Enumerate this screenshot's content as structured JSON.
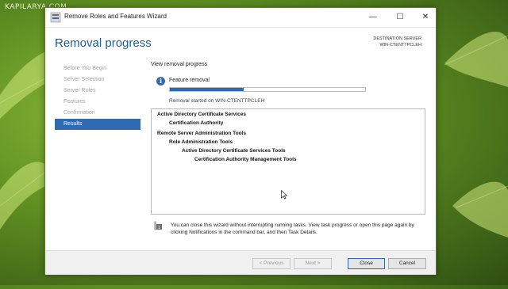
{
  "watermark": "KAPILARYA.COM",
  "window": {
    "title": "Remove Roles and Features Wizard",
    "controls": {
      "minimize": "—",
      "maximize": "☐",
      "close": "✕"
    }
  },
  "header": {
    "page_title": "Removal progress",
    "destination_label": "DESTINATION SERVER",
    "destination_value": "WIN-CTENTTPCLEH"
  },
  "nav": {
    "items": [
      {
        "label": "Before You Begin",
        "active": false
      },
      {
        "label": "Server Selection",
        "active": false
      },
      {
        "label": "Server Roles",
        "active": false
      },
      {
        "label": "Features",
        "active": false
      },
      {
        "label": "Confirmation",
        "active": false
      },
      {
        "label": "Results",
        "active": true
      }
    ]
  },
  "content": {
    "view_label": "View removal progress",
    "feature_label": "Feature removal",
    "progress": 0.38,
    "started_text": "Removal started on WIN-CTENTTPCLEH",
    "results_tree": [
      {
        "text": "Active Directory Certificate Services",
        "level": 0
      },
      {
        "text": "Certification Authority",
        "level": 1
      },
      {
        "text": "Remote Server Administration Tools",
        "level": 0
      },
      {
        "text": "Role Administration Tools",
        "level": 1
      },
      {
        "text": "Active Directory Certificate Services Tools",
        "level": 2
      },
      {
        "text": "Certification Authority Management Tools",
        "level": 3
      }
    ],
    "note": "You can close this wizard without interrupting running tasks. View task progress or open this page again by clicking Notifications in the command bar, and then Task Details."
  },
  "footer": {
    "previous": "< Previous",
    "next": "Next >",
    "close": "Close",
    "cancel": "Cancel"
  }
}
